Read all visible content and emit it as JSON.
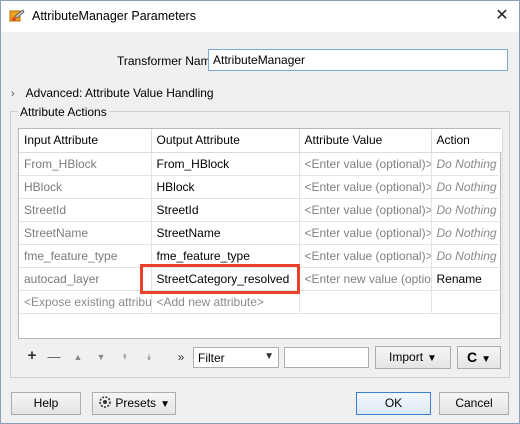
{
  "window": {
    "title": "AttributeManager Parameters",
    "close_glyph": "✕"
  },
  "transformer": {
    "label": "Transformer Name:",
    "value": "AttributeManager"
  },
  "advanced": {
    "chevron": "›",
    "label": "Advanced: Attribute Value Handling"
  },
  "actions_group": {
    "label": "Attribute Actions"
  },
  "table": {
    "columns": [
      "Input Attribute",
      "Output Attribute",
      "Attribute Value",
      "Action"
    ],
    "rows": [
      {
        "input": "From_HBlock",
        "output": "From_HBlock",
        "value": "<Enter value (optional)>",
        "action": "Do Nothing"
      },
      {
        "input": "HBlock",
        "output": "HBlock",
        "value": "<Enter value (optional)>",
        "action": "Do Nothing"
      },
      {
        "input": "StreetId",
        "output": "StreetId",
        "value": "<Enter value (optional)>",
        "action": "Do Nothing"
      },
      {
        "input": "StreetName",
        "output": "StreetName",
        "value": "<Enter value (optional)>",
        "action": "Do Nothing"
      },
      {
        "input": "fme_feature_type",
        "output": "fme_feature_type",
        "value": "<Enter value (optional)>",
        "action": "Do Nothing"
      },
      {
        "input": "autocad_layer",
        "output": "StreetCategory_resolved",
        "value": "<Enter new value (optional)>",
        "action": "Rename"
      }
    ],
    "footer": {
      "input": "<Expose existing attribute>",
      "output": "<Add new attribute>"
    }
  },
  "toolbar": {
    "add": "+",
    "remove": "—",
    "up": "▲",
    "down": "▼",
    "top": "⯭",
    "bottom": "⯯",
    "more": "»",
    "filter_selected": "Filter",
    "import_label": "Import",
    "refresh_glyph": "C"
  },
  "buttons": {
    "help": "Help",
    "presets": "Presets",
    "ok": "OK",
    "cancel": "Cancel"
  },
  "colors": {
    "highlight": "#e8422f",
    "link_blue": "#3c7fd0"
  }
}
